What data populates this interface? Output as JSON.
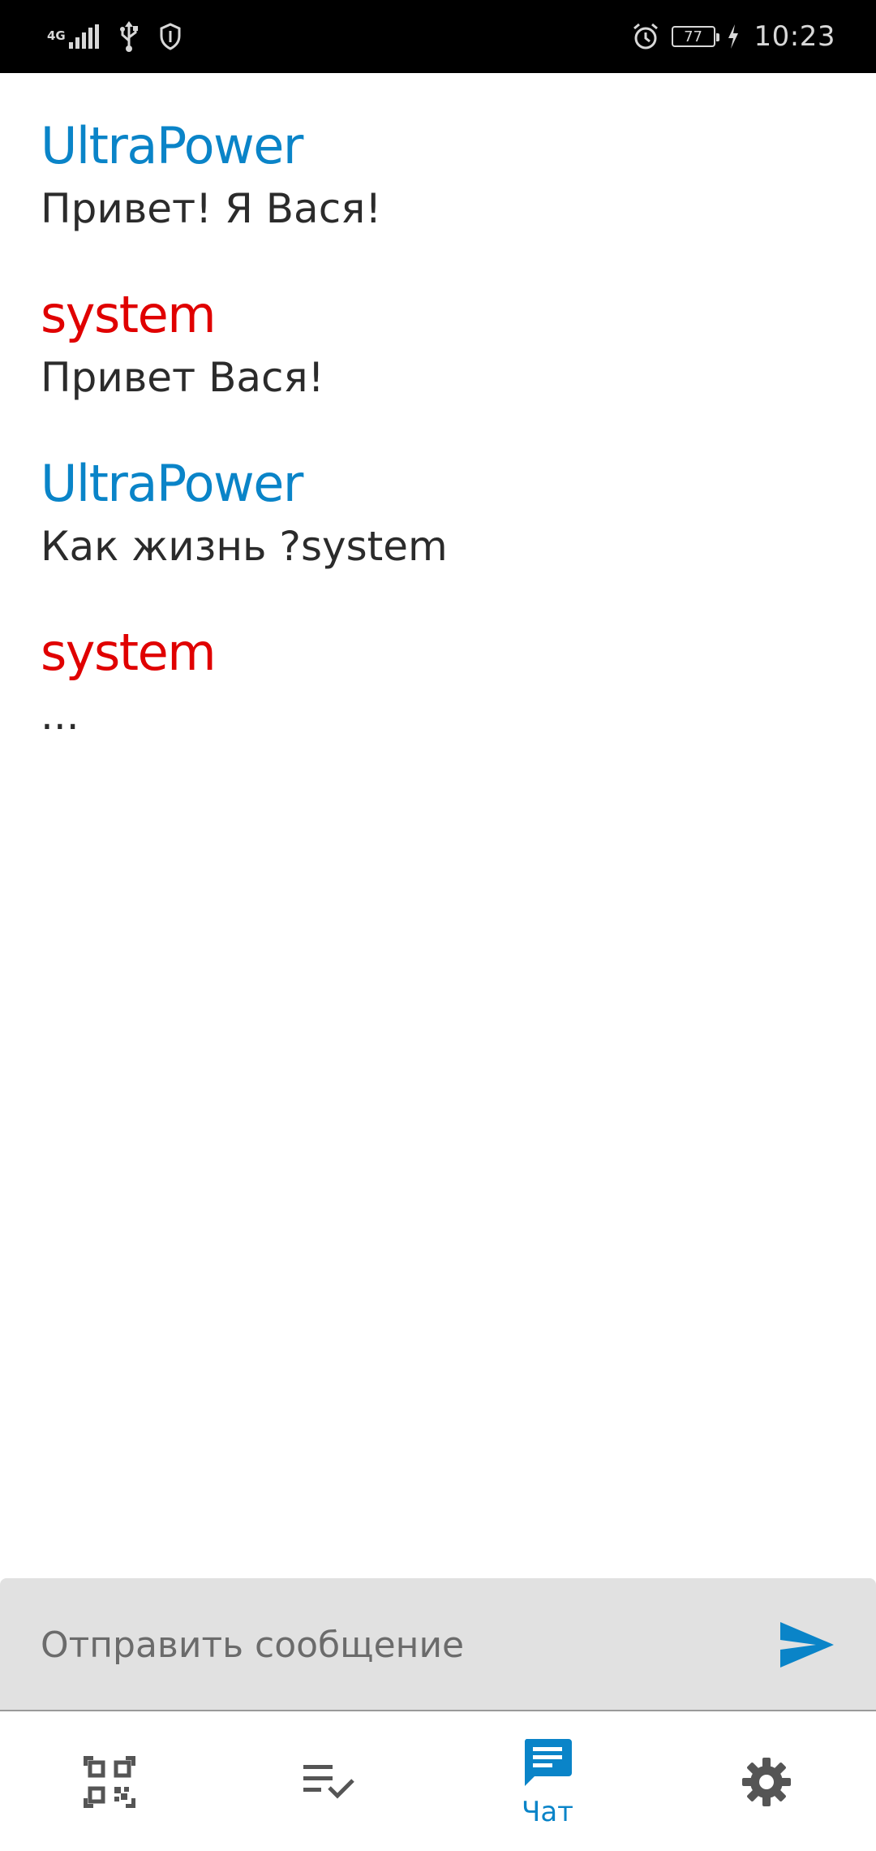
{
  "status_bar": {
    "network_type": "4G",
    "battery_level": "77",
    "time": "10:23",
    "icons": [
      "signal-icon",
      "usb-icon",
      "shield-icon",
      "alarm-icon",
      "battery-icon",
      "charging-icon"
    ]
  },
  "colors": {
    "user_accent": "#0a84c8",
    "system_accent": "#e00000",
    "nav_active": "#0a84c8",
    "nav_inactive": "#555555",
    "input_background": "#e1e1e1"
  },
  "messages": [
    {
      "sender": "UltraPower",
      "role": "user",
      "text": "Привет! Я Вася!"
    },
    {
      "sender": "system",
      "role": "system",
      "text": "Привет Вася!"
    },
    {
      "sender": "UltraPower",
      "role": "user",
      "text": "Как жизнь ?system"
    },
    {
      "sender": "system",
      "role": "system",
      "text": "..."
    }
  ],
  "composer": {
    "placeholder": "Отправить сообщение",
    "value": "",
    "send_icon": "send-icon"
  },
  "bottom_nav": {
    "items": [
      {
        "icon": "qr-code-icon",
        "label": "",
        "active": false
      },
      {
        "icon": "checklist-icon",
        "label": "",
        "active": false
      },
      {
        "icon": "chat-icon",
        "label": "Чат",
        "active": true
      },
      {
        "icon": "gear-icon",
        "label": "",
        "active": false
      }
    ]
  }
}
